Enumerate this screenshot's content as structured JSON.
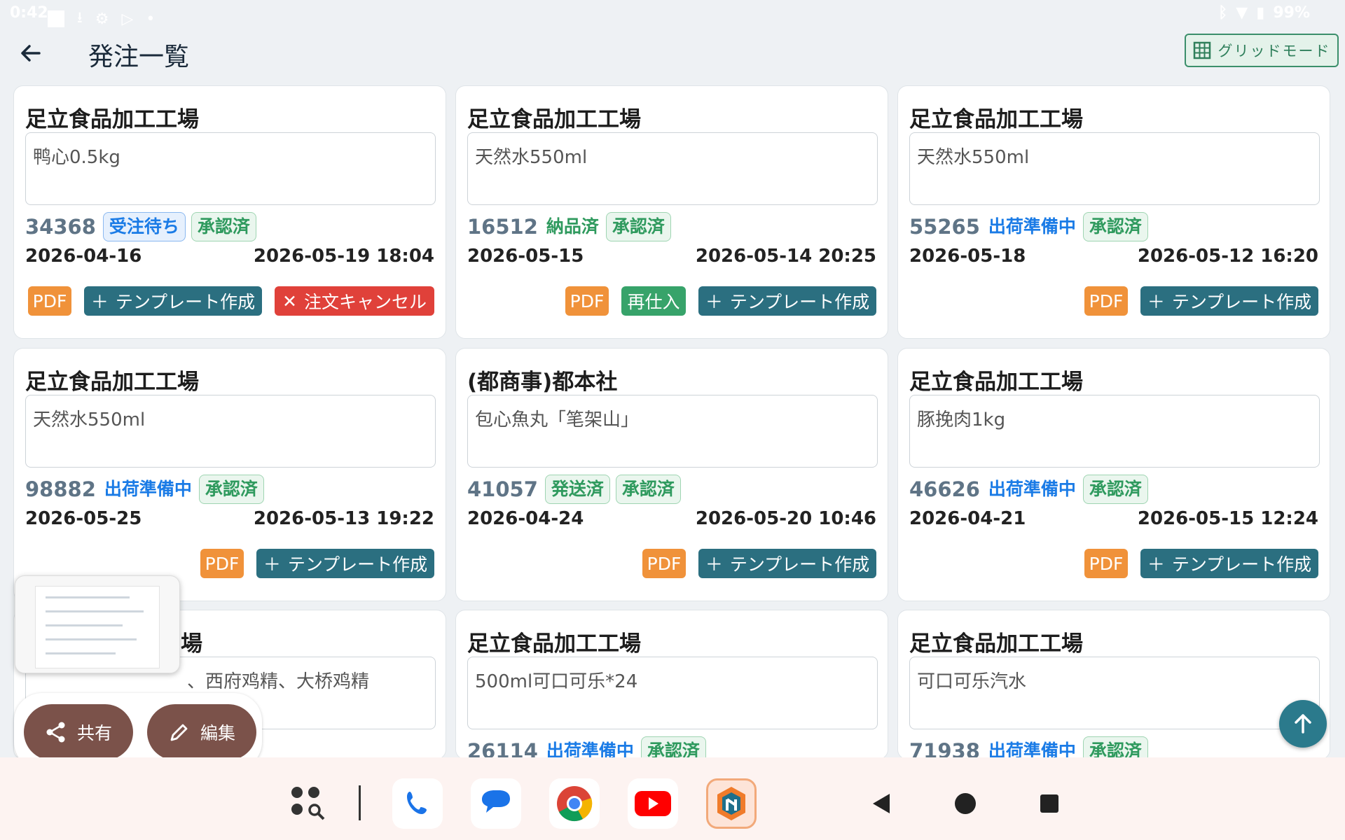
{
  "status_bar": {
    "time": "0:42",
    "battery": "99%"
  },
  "app_bar": {
    "title": "発注一覧",
    "grid_mode_label": "グリッドモード"
  },
  "cards": [
    {
      "supplier": "足立食品加工工場",
      "memo": "鸭心0.5kg",
      "number": "34368",
      "status": "受注待ち",
      "approval": "承認済",
      "date": "2026-04-16",
      "datetime": "2026-05-19 18:04",
      "pdf": "PDF",
      "template": "テンプレート作成",
      "cancel": "注文キャンセル"
    },
    {
      "supplier": "足立食品加工工場",
      "memo": "天然水550ml",
      "number": "16512",
      "status": "納品済",
      "approval": "承認済",
      "date": "2026-05-15",
      "datetime": "2026-05-14 20:25",
      "pdf": "PDF",
      "repurchase": "再仕入",
      "template": "テンプレート作成"
    },
    {
      "supplier": "足立食品加工工場",
      "memo": "天然水550ml",
      "number": "55265",
      "status": "出荷準備中",
      "approval": "承認済",
      "date": "2026-05-18",
      "datetime": "2026-05-12 16:20",
      "pdf": "PDF",
      "template": "テンプレート作成"
    },
    {
      "supplier": "足立食品加工工場",
      "memo": "天然水550ml",
      "number": "98882",
      "status": "出荷準備中",
      "approval": "承認済",
      "date": "2026-05-25",
      "datetime": "2026-05-13 19:22",
      "pdf": "PDF",
      "template": "テンプレート作成"
    },
    {
      "supplier": "(都商事)都本社",
      "memo": "包心魚丸「笔架山」",
      "number": "41057",
      "status": "発送済",
      "approval": "承認済",
      "date": "2026-04-24",
      "datetime": "2026-05-20 10:46",
      "pdf": "PDF",
      "template": "テンプレート作成"
    },
    {
      "supplier": "足立食品加工工場",
      "memo": "豚挽肉1kg",
      "number": "46626",
      "status": "出荷準備中",
      "approval": "承認済",
      "date": "2026-04-21",
      "datetime": "2026-05-15 12:24",
      "pdf": "PDF",
      "template": "テンプレート作成"
    },
    {
      "supplier": "場",
      "memo": "、西府鸡精、大桥鸡精"
    },
    {
      "supplier": "足立食品加工工場",
      "memo": "500ml可口可乐*24",
      "number": "26114",
      "status": "出荷準備中",
      "approval": "承認済"
    },
    {
      "supplier": "足立食品加工工場",
      "memo": "可口可乐汽水",
      "number": "71938",
      "status": "出荷準備中",
      "approval": "承認済"
    }
  ],
  "fab": {
    "share": "共有",
    "edit": "編集"
  },
  "colors": {
    "teal": "#2b6f80",
    "orange": "#f0923a",
    "red": "#e0413a",
    "green": "#37a36a",
    "fab_brown": "#7b524a"
  },
  "icons": {
    "back": "arrow-left-icon",
    "grid": "grid-icon",
    "share": "share-icon",
    "edit": "pencil-icon",
    "scroll_top": "arrow-up-icon"
  }
}
